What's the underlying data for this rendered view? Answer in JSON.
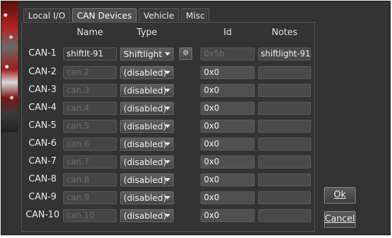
{
  "tabs": [
    {
      "label": "Local I/O"
    },
    {
      "label": "CAN Devices"
    },
    {
      "label": "Vehicle"
    },
    {
      "label": "Misc"
    }
  ],
  "active_tab": "CAN Devices",
  "headers": {
    "name": "Name",
    "type": "Type",
    "id": "Id",
    "notes": "Notes"
  },
  "rows": [
    {
      "label": "CAN-1",
      "name": "shiftlt-91",
      "type": "Shiftlight",
      "id": "0x5b",
      "notes": "shiftlight-91"
    },
    {
      "label": "CAN-2",
      "name": "can.2",
      "type": "(disabled)",
      "id": "0x0",
      "notes": ""
    },
    {
      "label": "CAN-3",
      "name": "can.3",
      "type": "(disabled)",
      "id": "0x0",
      "notes": ""
    },
    {
      "label": "CAN-4",
      "name": "can.4",
      "type": "(disabled)",
      "id": "0x0",
      "notes": ""
    },
    {
      "label": "CAN-5",
      "name": "can.5",
      "type": "(disabled)",
      "id": "0x0",
      "notes": ""
    },
    {
      "label": "CAN-6",
      "name": "can.6",
      "type": "(disabled)",
      "id": "0x0",
      "notes": ""
    },
    {
      "label": "CAN-7",
      "name": "can.7",
      "type": "(disabled)",
      "id": "0x0",
      "notes": ""
    },
    {
      "label": "CAN-8",
      "name": "can.8",
      "type": "(disabled)",
      "id": "0x0",
      "notes": ""
    },
    {
      "label": "CAN-9",
      "name": "can.9",
      "type": "(disabled)",
      "id": "0x0",
      "notes": ""
    },
    {
      "label": "CAN-10",
      "name": "can.10",
      "type": "(disabled)",
      "id": "0x0",
      "notes": ""
    }
  ],
  "buttons": {
    "ok": "Ok",
    "cancel": "Cancel"
  },
  "icons": {
    "config": "gear-icon",
    "dropdown": "chevron-down-icon"
  },
  "colors": {
    "window_bg": "#333333",
    "field_bg": "#454545",
    "text": "#f2f2f2",
    "disabled_text": "#6b6b6b"
  }
}
